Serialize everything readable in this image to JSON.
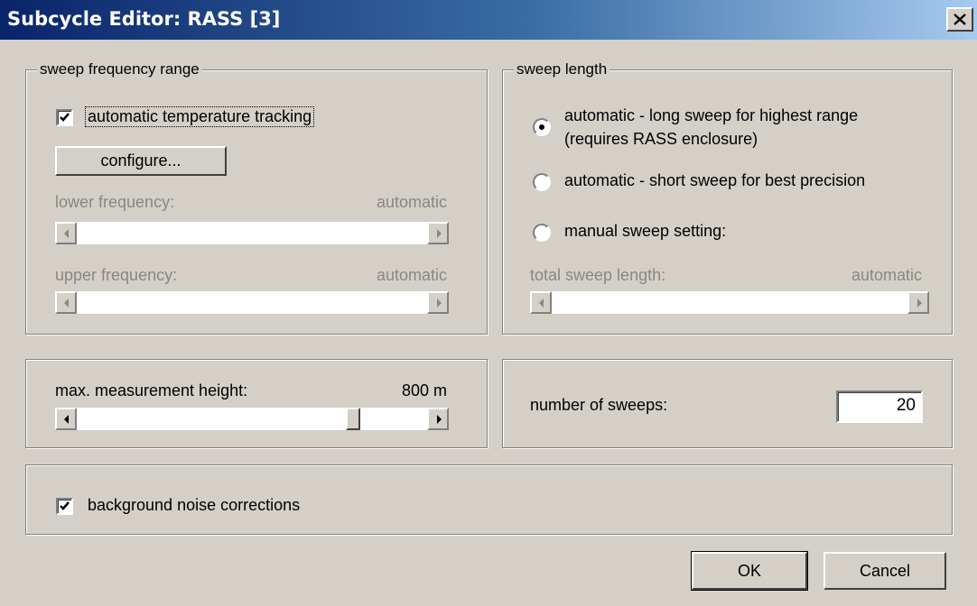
{
  "window": {
    "title": "Subcycle Editor: RASS [3]",
    "close_label": "close"
  },
  "sweep_frequency_range": {
    "group_label": "sweep frequency range",
    "auto_temp_tracking": {
      "label": "automatic temperature tracking",
      "checked": true
    },
    "configure_button": "configure...",
    "lower_frequency": {
      "label": "lower frequency:",
      "value": "automatic",
      "enabled": false
    },
    "upper_frequency": {
      "label": "upper frequency:",
      "value": "automatic",
      "enabled": false
    }
  },
  "sweep_length": {
    "group_label": "sweep length",
    "options": [
      {
        "label_line1": "automatic - long sweep for highest range",
        "label_line2": "(requires RASS enclosure)",
        "selected": true
      },
      {
        "label_line1": "automatic - short sweep for best precision",
        "selected": false
      },
      {
        "label_line1": "manual sweep setting:",
        "selected": false
      }
    ],
    "total_sweep_length": {
      "label": "total sweep length:",
      "value": "automatic",
      "enabled": false
    }
  },
  "measurement_height": {
    "label": "max. measurement height:",
    "value": "800 m",
    "slider_fraction": 0.8
  },
  "sweeps": {
    "label": "number of sweeps:",
    "value": "20"
  },
  "noise": {
    "label": "background noise corrections",
    "checked": true
  },
  "footer": {
    "ok_label": "OK",
    "cancel_label": "Cancel"
  },
  "colors": {
    "face": "#d4d0c8",
    "title_start": "#0a246a",
    "title_end": "#a6caf0",
    "disabled_text": "#8a8783"
  }
}
